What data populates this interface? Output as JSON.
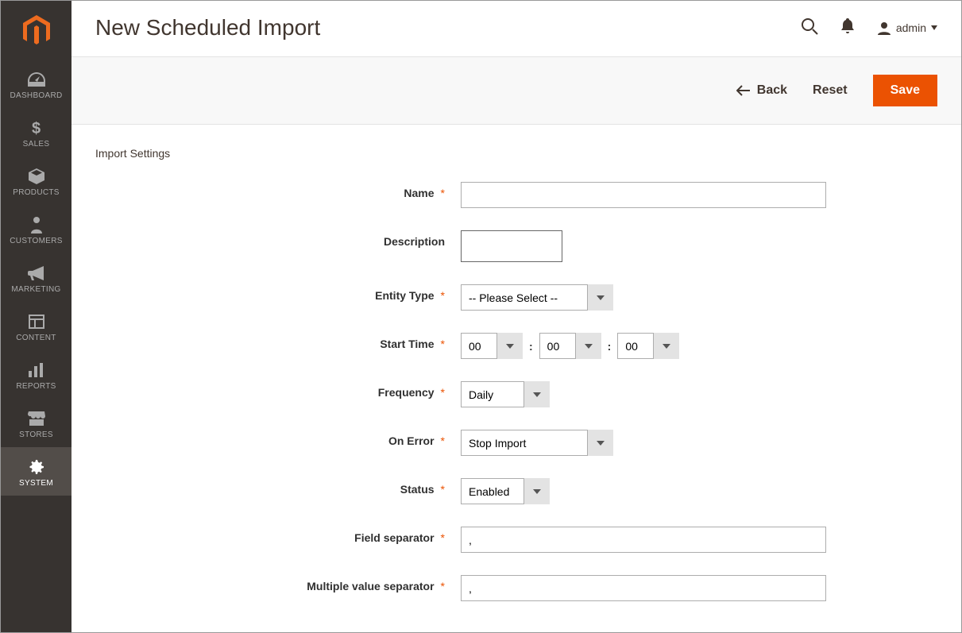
{
  "header": {
    "title": "New Scheduled Import",
    "account_label": "admin"
  },
  "sidebar": {
    "items": [
      {
        "label": "DASHBOARD"
      },
      {
        "label": "SALES"
      },
      {
        "label": "PRODUCTS"
      },
      {
        "label": "CUSTOMERS"
      },
      {
        "label": "MARKETING"
      },
      {
        "label": "CONTENT"
      },
      {
        "label": "REPORTS"
      },
      {
        "label": "STORES"
      },
      {
        "label": "SYSTEM"
      }
    ]
  },
  "actions": {
    "back": "Back",
    "reset": "Reset",
    "save": "Save"
  },
  "section": {
    "title": "Import Settings"
  },
  "form": {
    "name": {
      "label": "Name",
      "value": ""
    },
    "description": {
      "label": "Description",
      "value": ""
    },
    "entity_type": {
      "label": "Entity Type",
      "value": "-- Please Select --"
    },
    "start_time": {
      "label": "Start Time",
      "hh": "00",
      "mm": "00",
      "ss": "00"
    },
    "frequency": {
      "label": "Frequency",
      "value": "Daily"
    },
    "on_error": {
      "label": "On Error",
      "value": "Stop Import"
    },
    "status": {
      "label": "Status",
      "value": "Enabled"
    },
    "field_sep": {
      "label": "Field separator",
      "value": ","
    },
    "multi_sep": {
      "label": "Multiple value separator",
      "value": ","
    }
  }
}
